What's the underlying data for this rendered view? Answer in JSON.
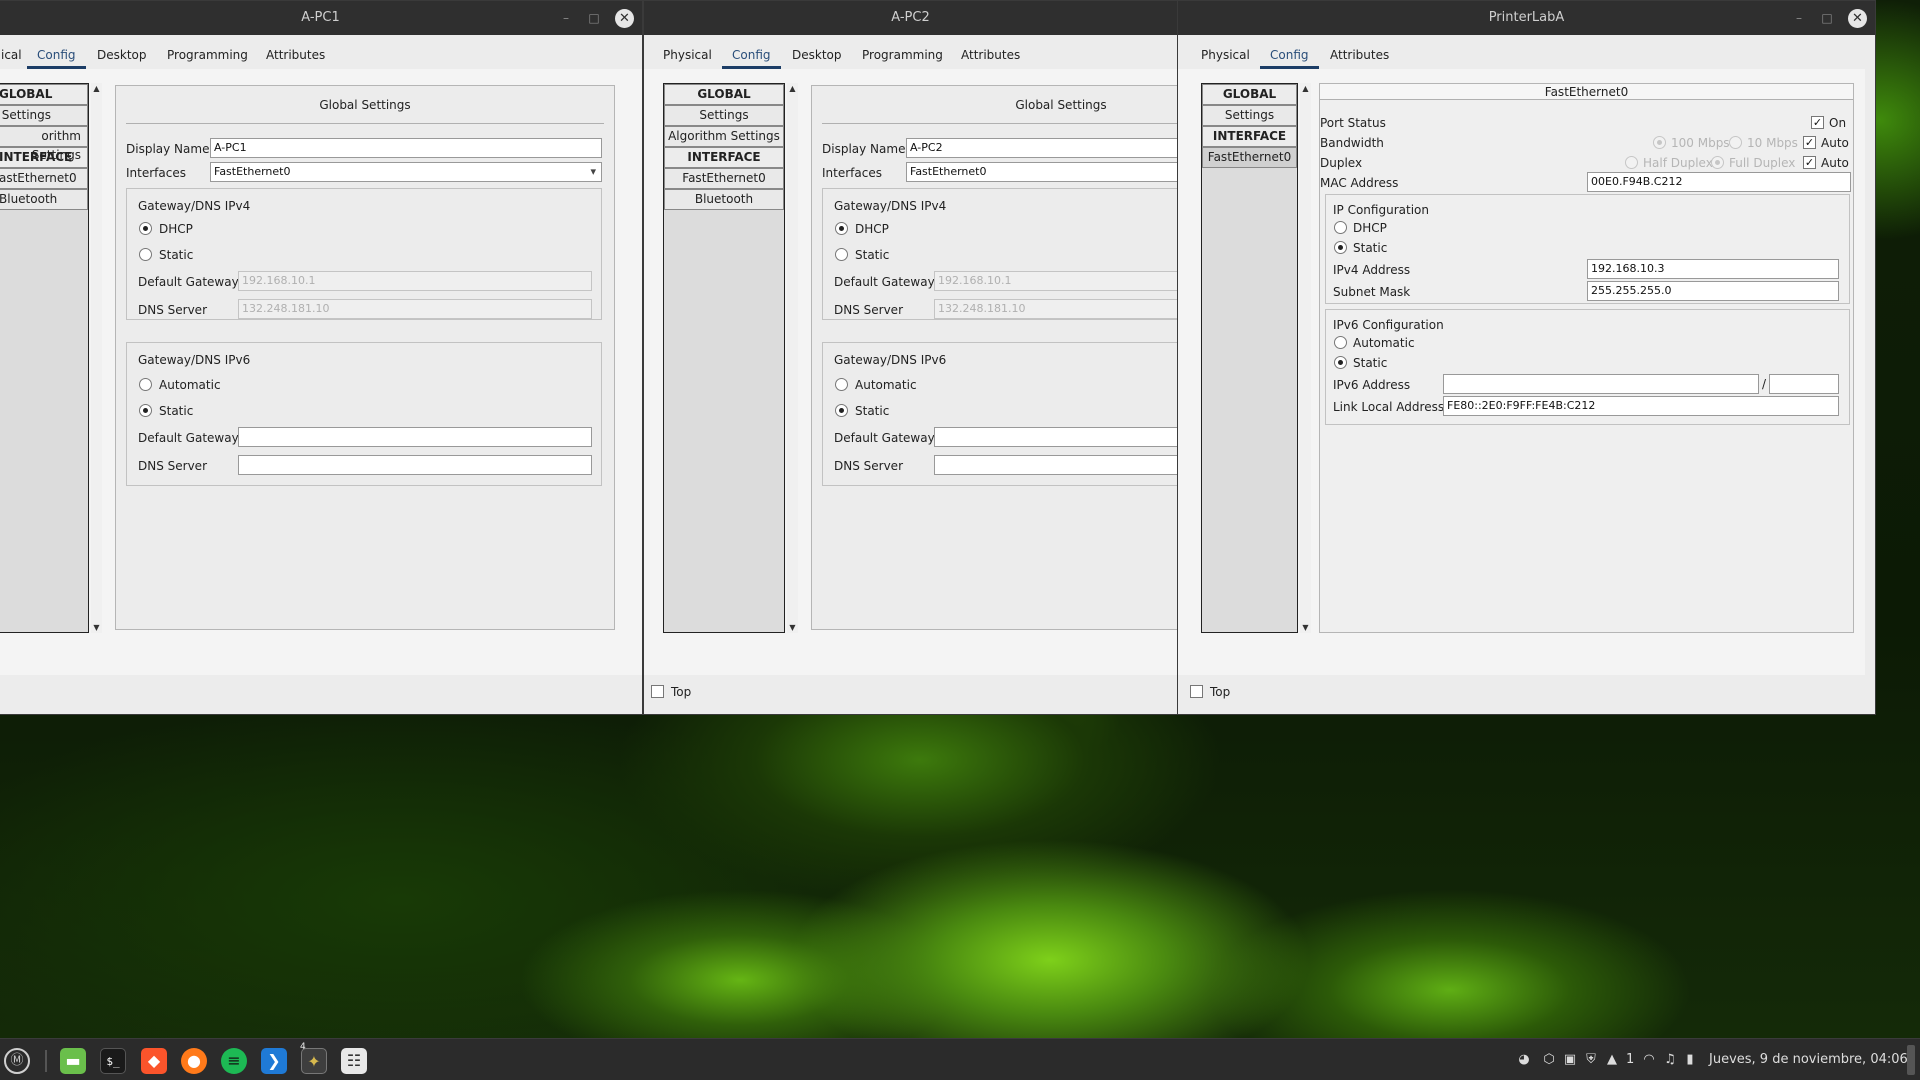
{
  "windows": {
    "apc1": {
      "title": "A-PC1",
      "tabs": [
        "ical",
        "Config",
        "Desktop",
        "Programming",
        "Attributes"
      ],
      "list": [
        "GLOBAL",
        "Settings",
        "orithm Settings",
        "INTERFACE",
        "astEthernet0",
        "Bluetooth"
      ],
      "section_title": "Global Settings",
      "display_name_label": "Display Name",
      "display_name": "A-PC1",
      "interfaces_label": "Interfaces",
      "interface_value": "FastEthernet0",
      "ipv4_title": "Gateway/DNS IPv4",
      "dhcp": "DHCP",
      "static": "Static",
      "default_gateway_label": "Default Gateway",
      "default_gateway": "192.168.10.1",
      "dns_label": "DNS Server",
      "dns": "132.248.181.10",
      "ipv6_title": "Gateway/DNS IPv6",
      "automatic": "Automatic",
      "static6": "Static",
      "default_gateway6_label": "Default Gateway",
      "dns6_label": "DNS Server"
    },
    "apc2": {
      "title": "A-PC2",
      "tabs": [
        "Physical",
        "Config",
        "Desktop",
        "Programming",
        "Attributes"
      ],
      "list": [
        "GLOBAL",
        "Settings",
        "Algorithm Settings",
        "INTERFACE",
        "FastEthernet0",
        "Bluetooth"
      ],
      "section_title": "Global Settings",
      "display_name_label": "Display Name",
      "display_name": "A-PC2",
      "interfaces_label": "Interfaces",
      "interface_value": "FastEthernet0",
      "ipv4_title": "Gateway/DNS IPv4",
      "dhcp": "DHCP",
      "static": "Static",
      "default_gateway_label": "Default Gateway",
      "default_gateway": "192.168.10.1",
      "dns_label": "DNS Server",
      "dns": "132.248.181.10",
      "ipv6_title": "Gateway/DNS IPv6",
      "automatic": "Automatic",
      "static6": "Static",
      "default_gateway6_label": "Default Gateway",
      "dns6_label": "DNS Server",
      "top_label": "Top"
    },
    "printer": {
      "title": "PrinterLabA",
      "tabs": [
        "Physical",
        "Config",
        "Attributes"
      ],
      "list": [
        "GLOBAL",
        "Settings",
        "INTERFACE",
        "FastEthernet0"
      ],
      "section_title": "FastEthernet0",
      "port_status_label": "Port Status",
      "on_label": "On",
      "bandwidth_label": "Bandwidth",
      "bw_100": "100 Mbps",
      "bw_10": "10 Mbps",
      "auto_label": "Auto",
      "duplex_label": "Duplex",
      "half_duplex": "Half Duplex",
      "full_duplex": "Full Duplex",
      "auto_label2": "Auto",
      "mac_label": "MAC Address",
      "mac": "00E0.F94B.C212",
      "ip_config_title": "IP Configuration",
      "dhcp": "DHCP",
      "static": "Static",
      "ipv4_label": "IPv4 Address",
      "ipv4": "192.168.10.3",
      "mask_label": "Subnet Mask",
      "mask": "255.255.255.0",
      "ipv6_config_title": "IPv6 Configuration",
      "automatic": "Automatic",
      "static6": "Static",
      "ipv6_label": "IPv6 Address",
      "slash": "/",
      "link_local_label": "Link Local Address:",
      "link_local": "FE80::2E0:F9FF:FE4B:C212",
      "top_label": "Top"
    }
  },
  "taskbar": {
    "badge": "4",
    "workspace": "1",
    "datetime": "Jueves, 9 de noviembre, 04:06"
  },
  "colors": {
    "titlebar": "#2f2f2f",
    "tab_accent": "#1c3d66",
    "taskbar": "#2b2b2b"
  }
}
